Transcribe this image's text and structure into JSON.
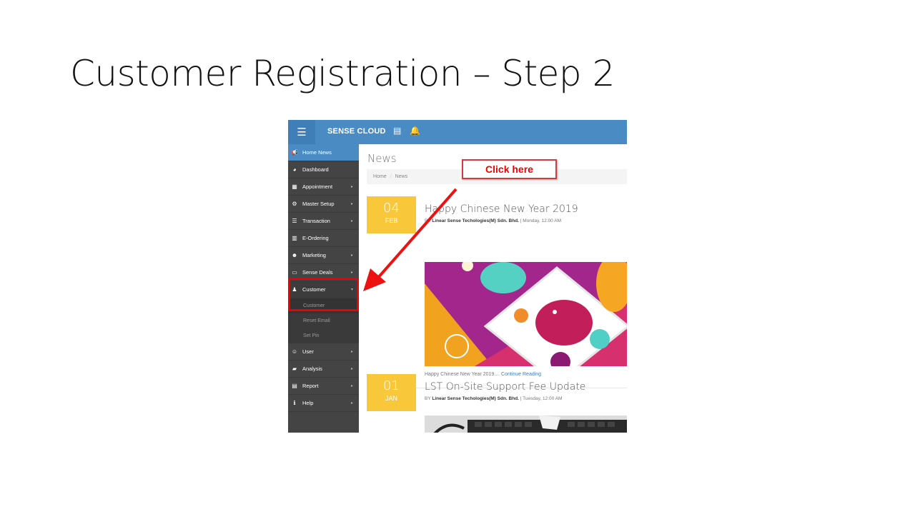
{
  "slide": {
    "title": "Customer Registration – Step 2"
  },
  "callout": {
    "label": "Click here"
  },
  "app": {
    "brand": "SENSE CLOUD",
    "topbar_icons": [
      "menu-icon",
      "server-icon",
      "bell-icon"
    ]
  },
  "sidebar": {
    "items": [
      {
        "label": "Home News",
        "icon": "bullhorn-icon",
        "glyph": "📢",
        "chevron": false,
        "active": true
      },
      {
        "label": "Dashboard",
        "icon": "dashboard-icon",
        "glyph": "◕",
        "chevron": false
      },
      {
        "label": "Appointment",
        "icon": "calendar-icon",
        "glyph": "▦",
        "chevron": true
      },
      {
        "label": "Master Setup",
        "icon": "cogs-icon",
        "glyph": "⚙",
        "chevron": true
      },
      {
        "label": "Transaction",
        "icon": "list-icon",
        "glyph": "☰",
        "chevron": true
      },
      {
        "label": "E-Ordering",
        "icon": "barcode-icon",
        "glyph": "▥",
        "chevron": false
      },
      {
        "label": "Marketing",
        "icon": "users-icon",
        "glyph": "☻",
        "chevron": true
      },
      {
        "label": "Sense Deals",
        "icon": "credit-card-icon",
        "glyph": "▭",
        "chevron": true
      },
      {
        "label": "Customer",
        "icon": "person-icon",
        "glyph": "♟",
        "chevron": "down",
        "open": true
      },
      {
        "label": "User",
        "icon": "smile-icon",
        "glyph": "☺",
        "chevron": true
      },
      {
        "label": "Analysis",
        "icon": "book-icon",
        "glyph": "▰",
        "chevron": true
      },
      {
        "label": "Report",
        "icon": "file-icon",
        "glyph": "▤",
        "chevron": true
      },
      {
        "label": "Help",
        "icon": "info-icon",
        "glyph": "ℹ",
        "chevron": true
      }
    ],
    "customer_sub": [
      "Customer",
      "Reset Email",
      "Set Pin"
    ]
  },
  "main": {
    "page_title": "News",
    "breadcrumb": [
      "Home",
      "News"
    ],
    "posts": [
      {
        "day": "04",
        "month": "FEB",
        "title": "Happy Chinese New Year 2019",
        "by": "BY",
        "author": "Linear Sense Techologies(M) Sdn. Bhd.",
        "when": "| Monday, 12:00 AM",
        "excerpt": "Happy Chinese New Year 2019....",
        "read_more": "Continue Reading"
      },
      {
        "day": "01",
        "month": "JAN",
        "title": "LST On-Site Support Fee Update",
        "by": "BY",
        "author": "Linear Sense Techologies(M) Sdn. Bhd.",
        "when": "| Tuesday, 12:00 AM"
      }
    ]
  }
}
